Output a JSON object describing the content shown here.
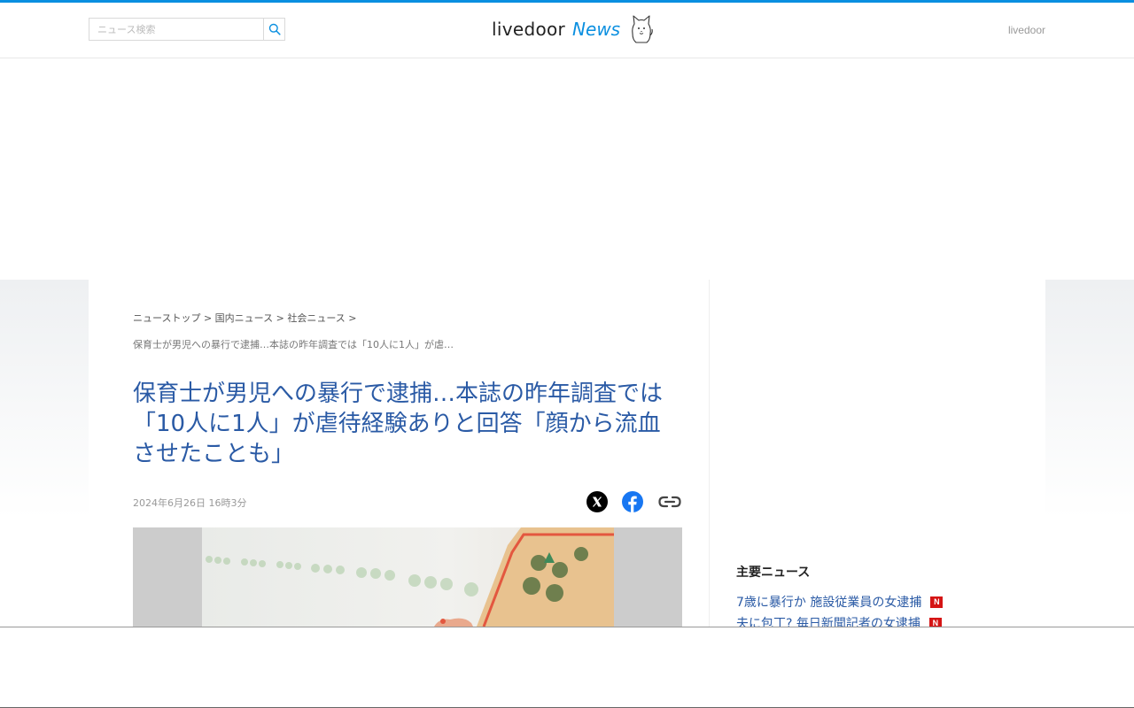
{
  "header": {
    "search_placeholder": "ニュース検索",
    "logo_text": "livedoor",
    "logo_news": "News",
    "right_link": "livedoor",
    "accent_color": "#0a8fe0"
  },
  "breadcrumb": {
    "items": [
      "ニューストップ",
      "国内ニュース",
      "社会ニュース"
    ],
    "separator": ">",
    "current": "保育士が男児への暴行で逮捕…本誌の昨年調査では「10人に1人」が虐…"
  },
  "article": {
    "title": "保育士が男児への暴行で逮捕…本誌の昨年調査では「10人に1人」が虐待経験ありと回答「顔から流血させたことも」",
    "date": "2024年6月26日 16時3分",
    "share_icons": [
      "x-icon",
      "facebook-icon",
      "link-icon"
    ]
  },
  "sidebar": {
    "heading": "主要ニュース",
    "items": [
      {
        "label": "7歳に暴行か 施設従業員の女逮捕",
        "badge": "N"
      },
      {
        "label": "夫に包丁? 毎日新聞記者の女逮捕",
        "badge": "N"
      }
    ]
  }
}
